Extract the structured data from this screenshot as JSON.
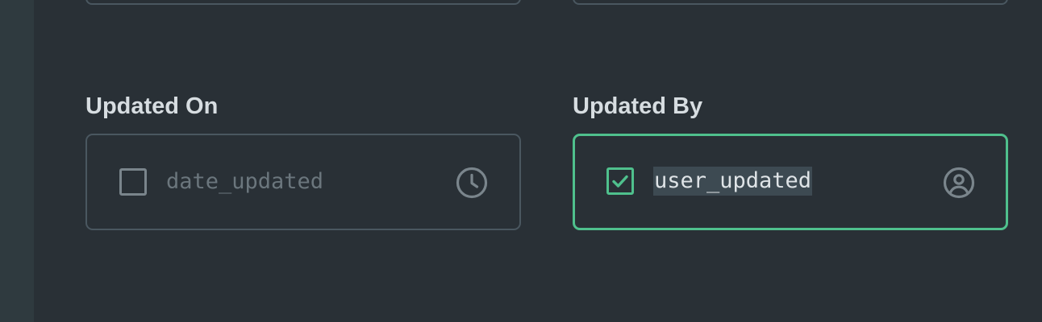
{
  "fields": {
    "updated_on": {
      "label": "Updated On",
      "key": "date_updated",
      "checked": false,
      "icon": "clock-icon"
    },
    "updated_by": {
      "label": "Updated By",
      "key": "user_updated",
      "checked": true,
      "icon": "account-circle-icon"
    }
  },
  "colors": {
    "background": "#293036",
    "accent": "#4fc08d",
    "border": "#4a5760",
    "label": "#d7dde1",
    "muted_text": "#6b767d"
  }
}
